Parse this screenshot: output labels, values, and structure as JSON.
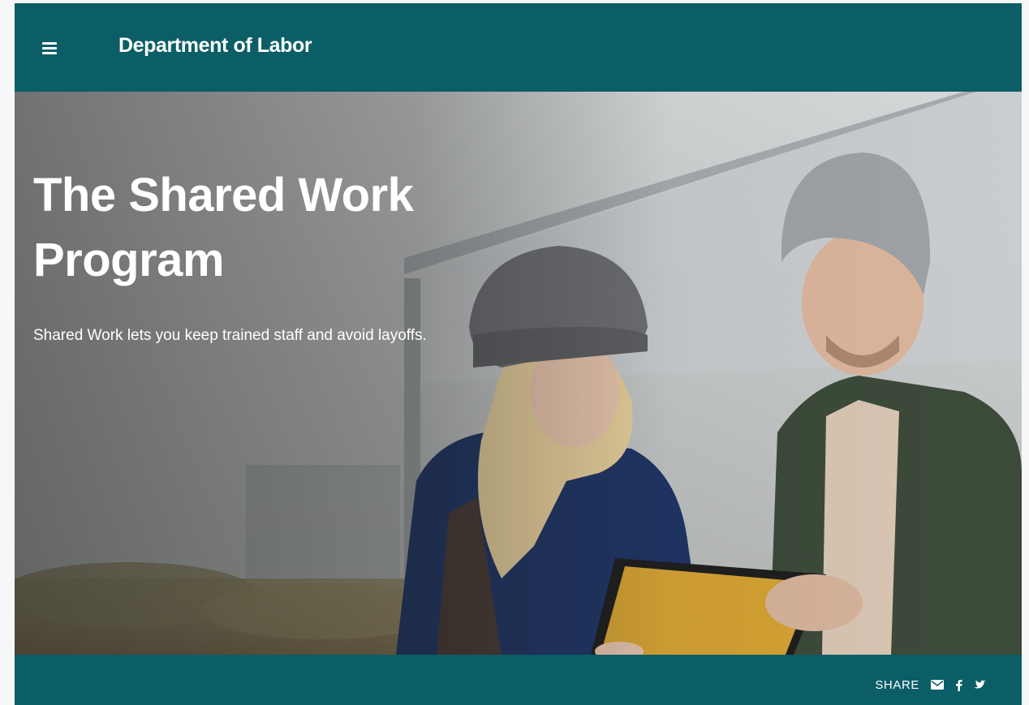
{
  "header": {
    "site_title": "Department of Labor",
    "menu_icon": "hamburger-menu-icon",
    "background_color": "#0b5e66"
  },
  "hero": {
    "title": "The Shared Work Program",
    "subtitle": "Shared Work lets you keep trained staff and avoid layoffs."
  },
  "footer": {
    "share_label": "SHARE",
    "share_icons": [
      "email-icon",
      "facebook-icon",
      "twitter-icon"
    ],
    "background_color": "#0b5e66"
  }
}
